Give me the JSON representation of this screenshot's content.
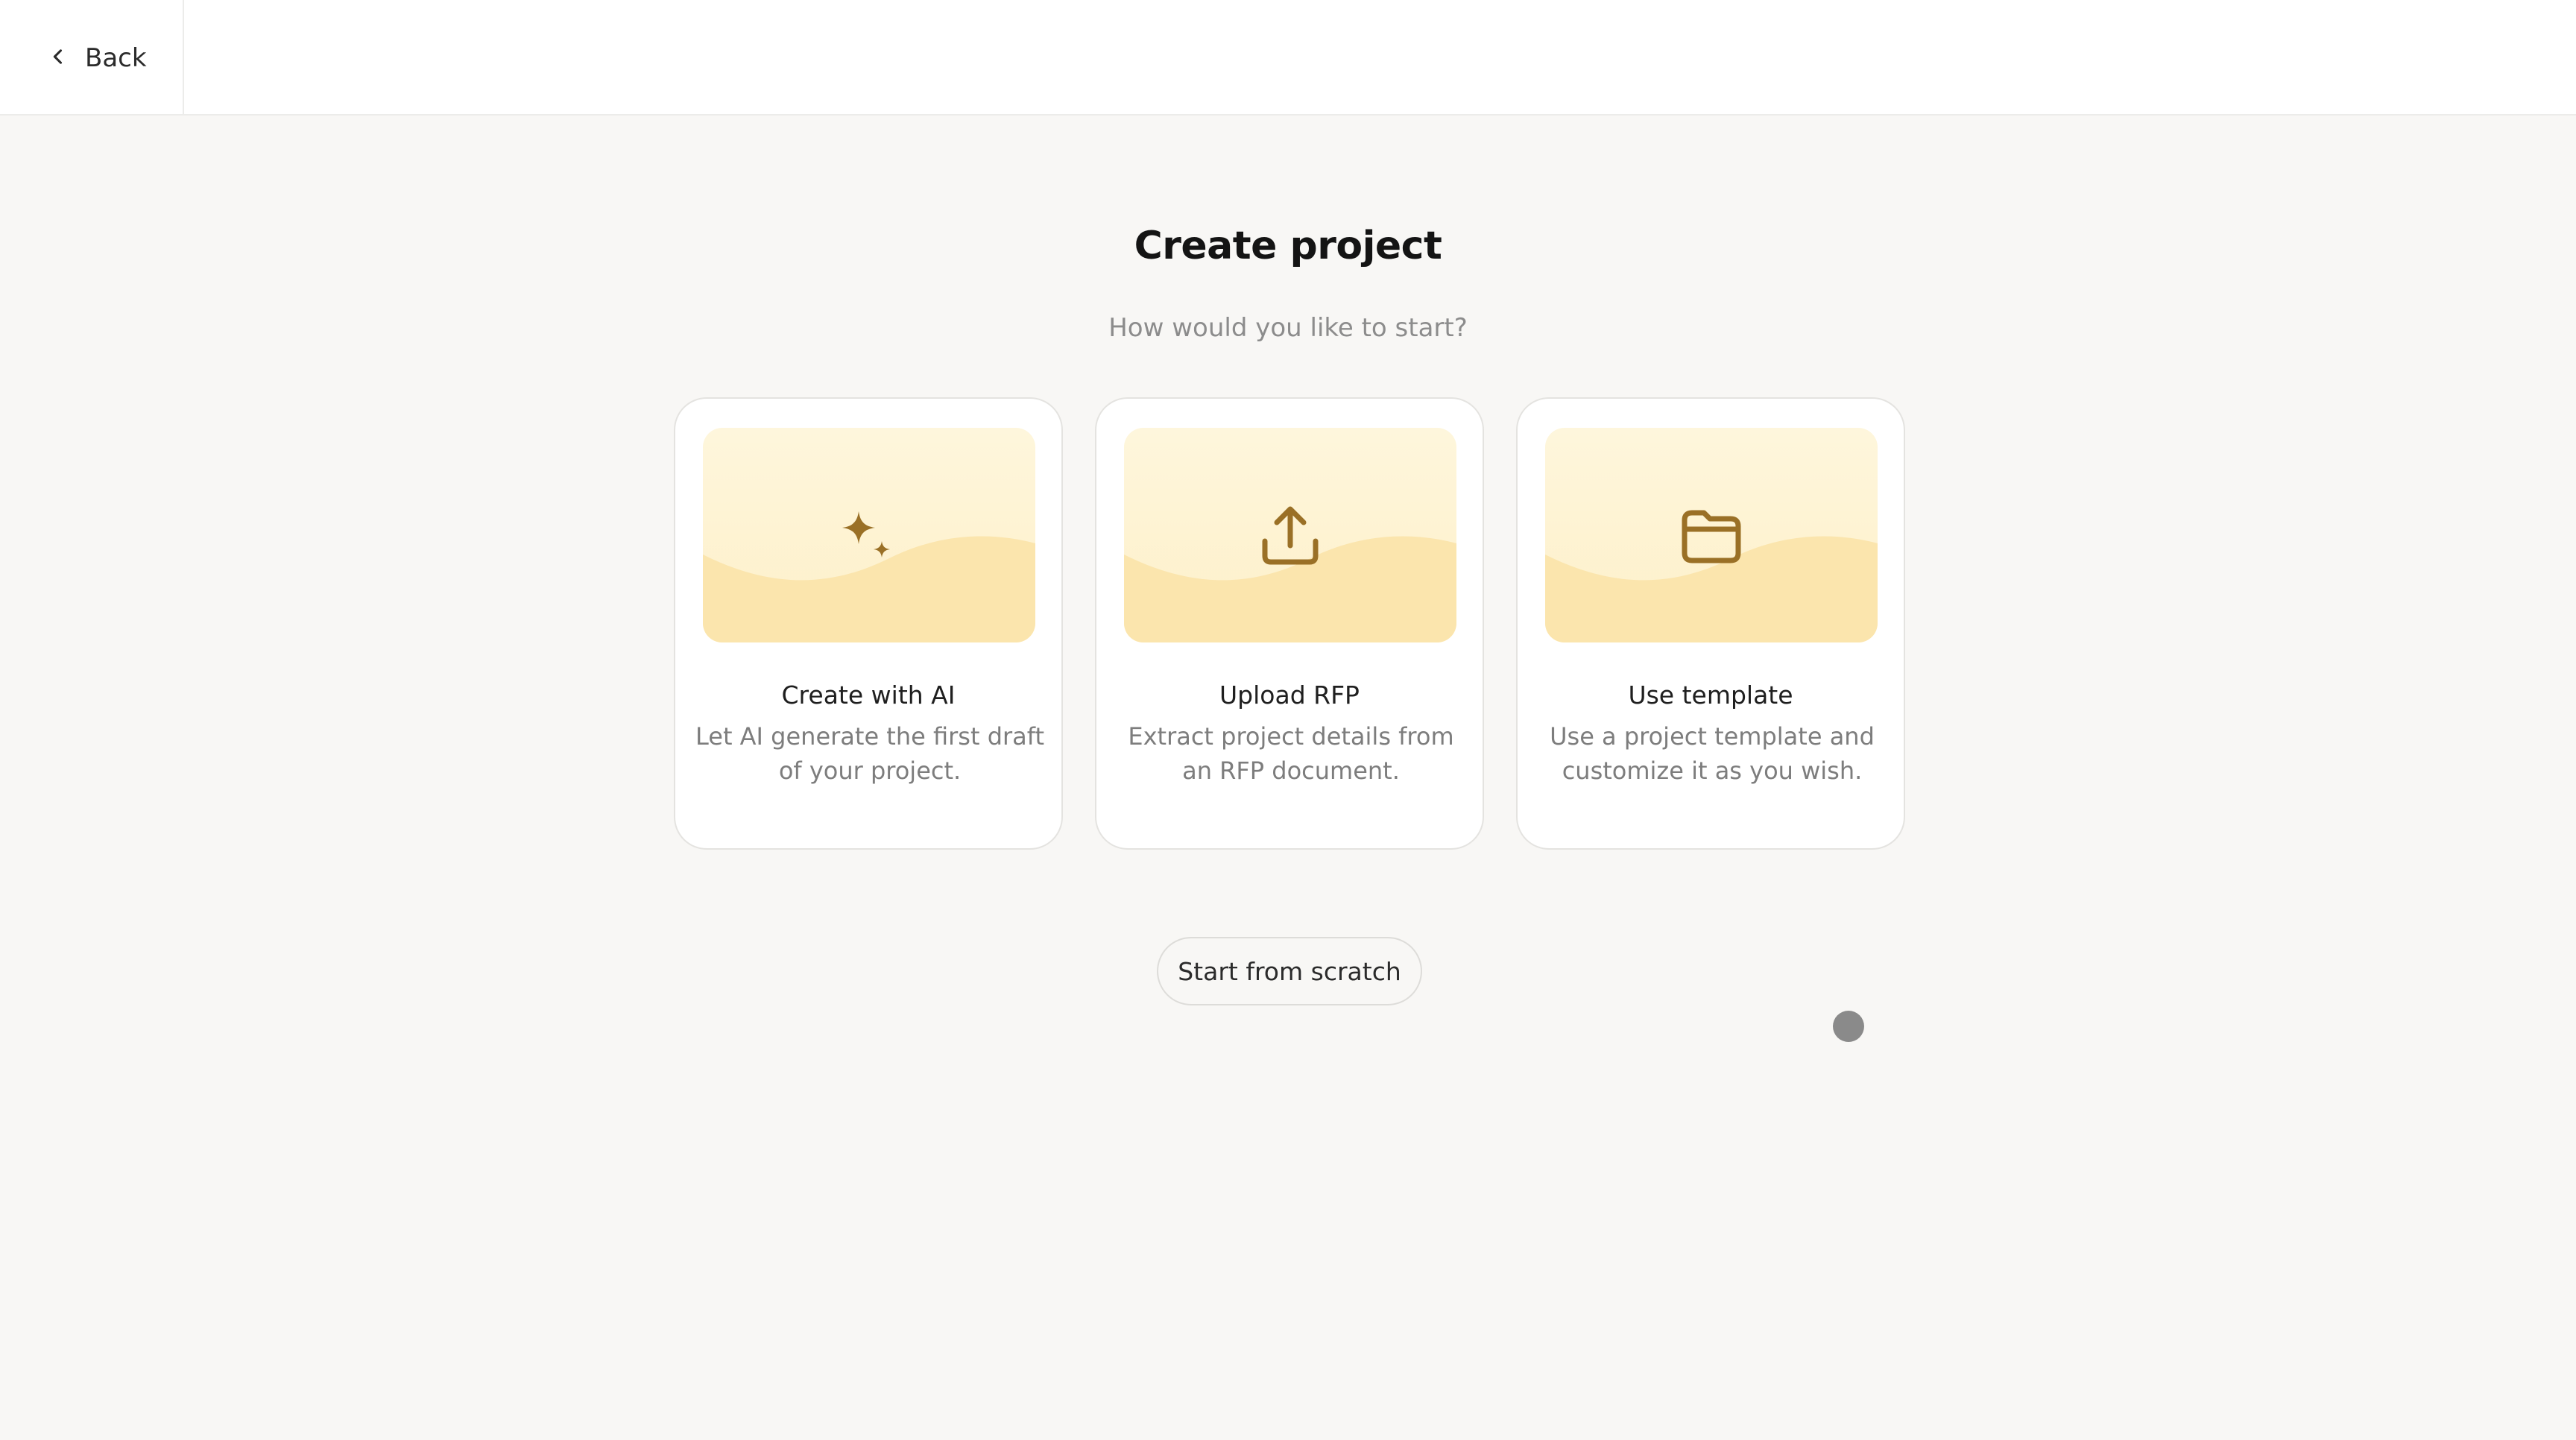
{
  "header": {
    "back_label": "Back"
  },
  "main": {
    "title": "Create project",
    "subtitle": "How would you like to start?",
    "options": [
      {
        "title": "Create with AI",
        "description": "Let AI generate the first draft of your project.",
        "icon": "sparkles-icon"
      },
      {
        "title": "Upload RFP",
        "description": "Extract project details from an RFP document.",
        "icon": "upload-icon"
      },
      {
        "title": "Use template",
        "description": "Use a project template and customize it as you wish.",
        "icon": "folder-icon"
      }
    ],
    "scratch_label": "Start from scratch"
  },
  "colors": {
    "accent": "#9a7026",
    "art_light": "#fef6dc",
    "art_dark": "#fae5ae",
    "background": "#f8f7f5"
  }
}
